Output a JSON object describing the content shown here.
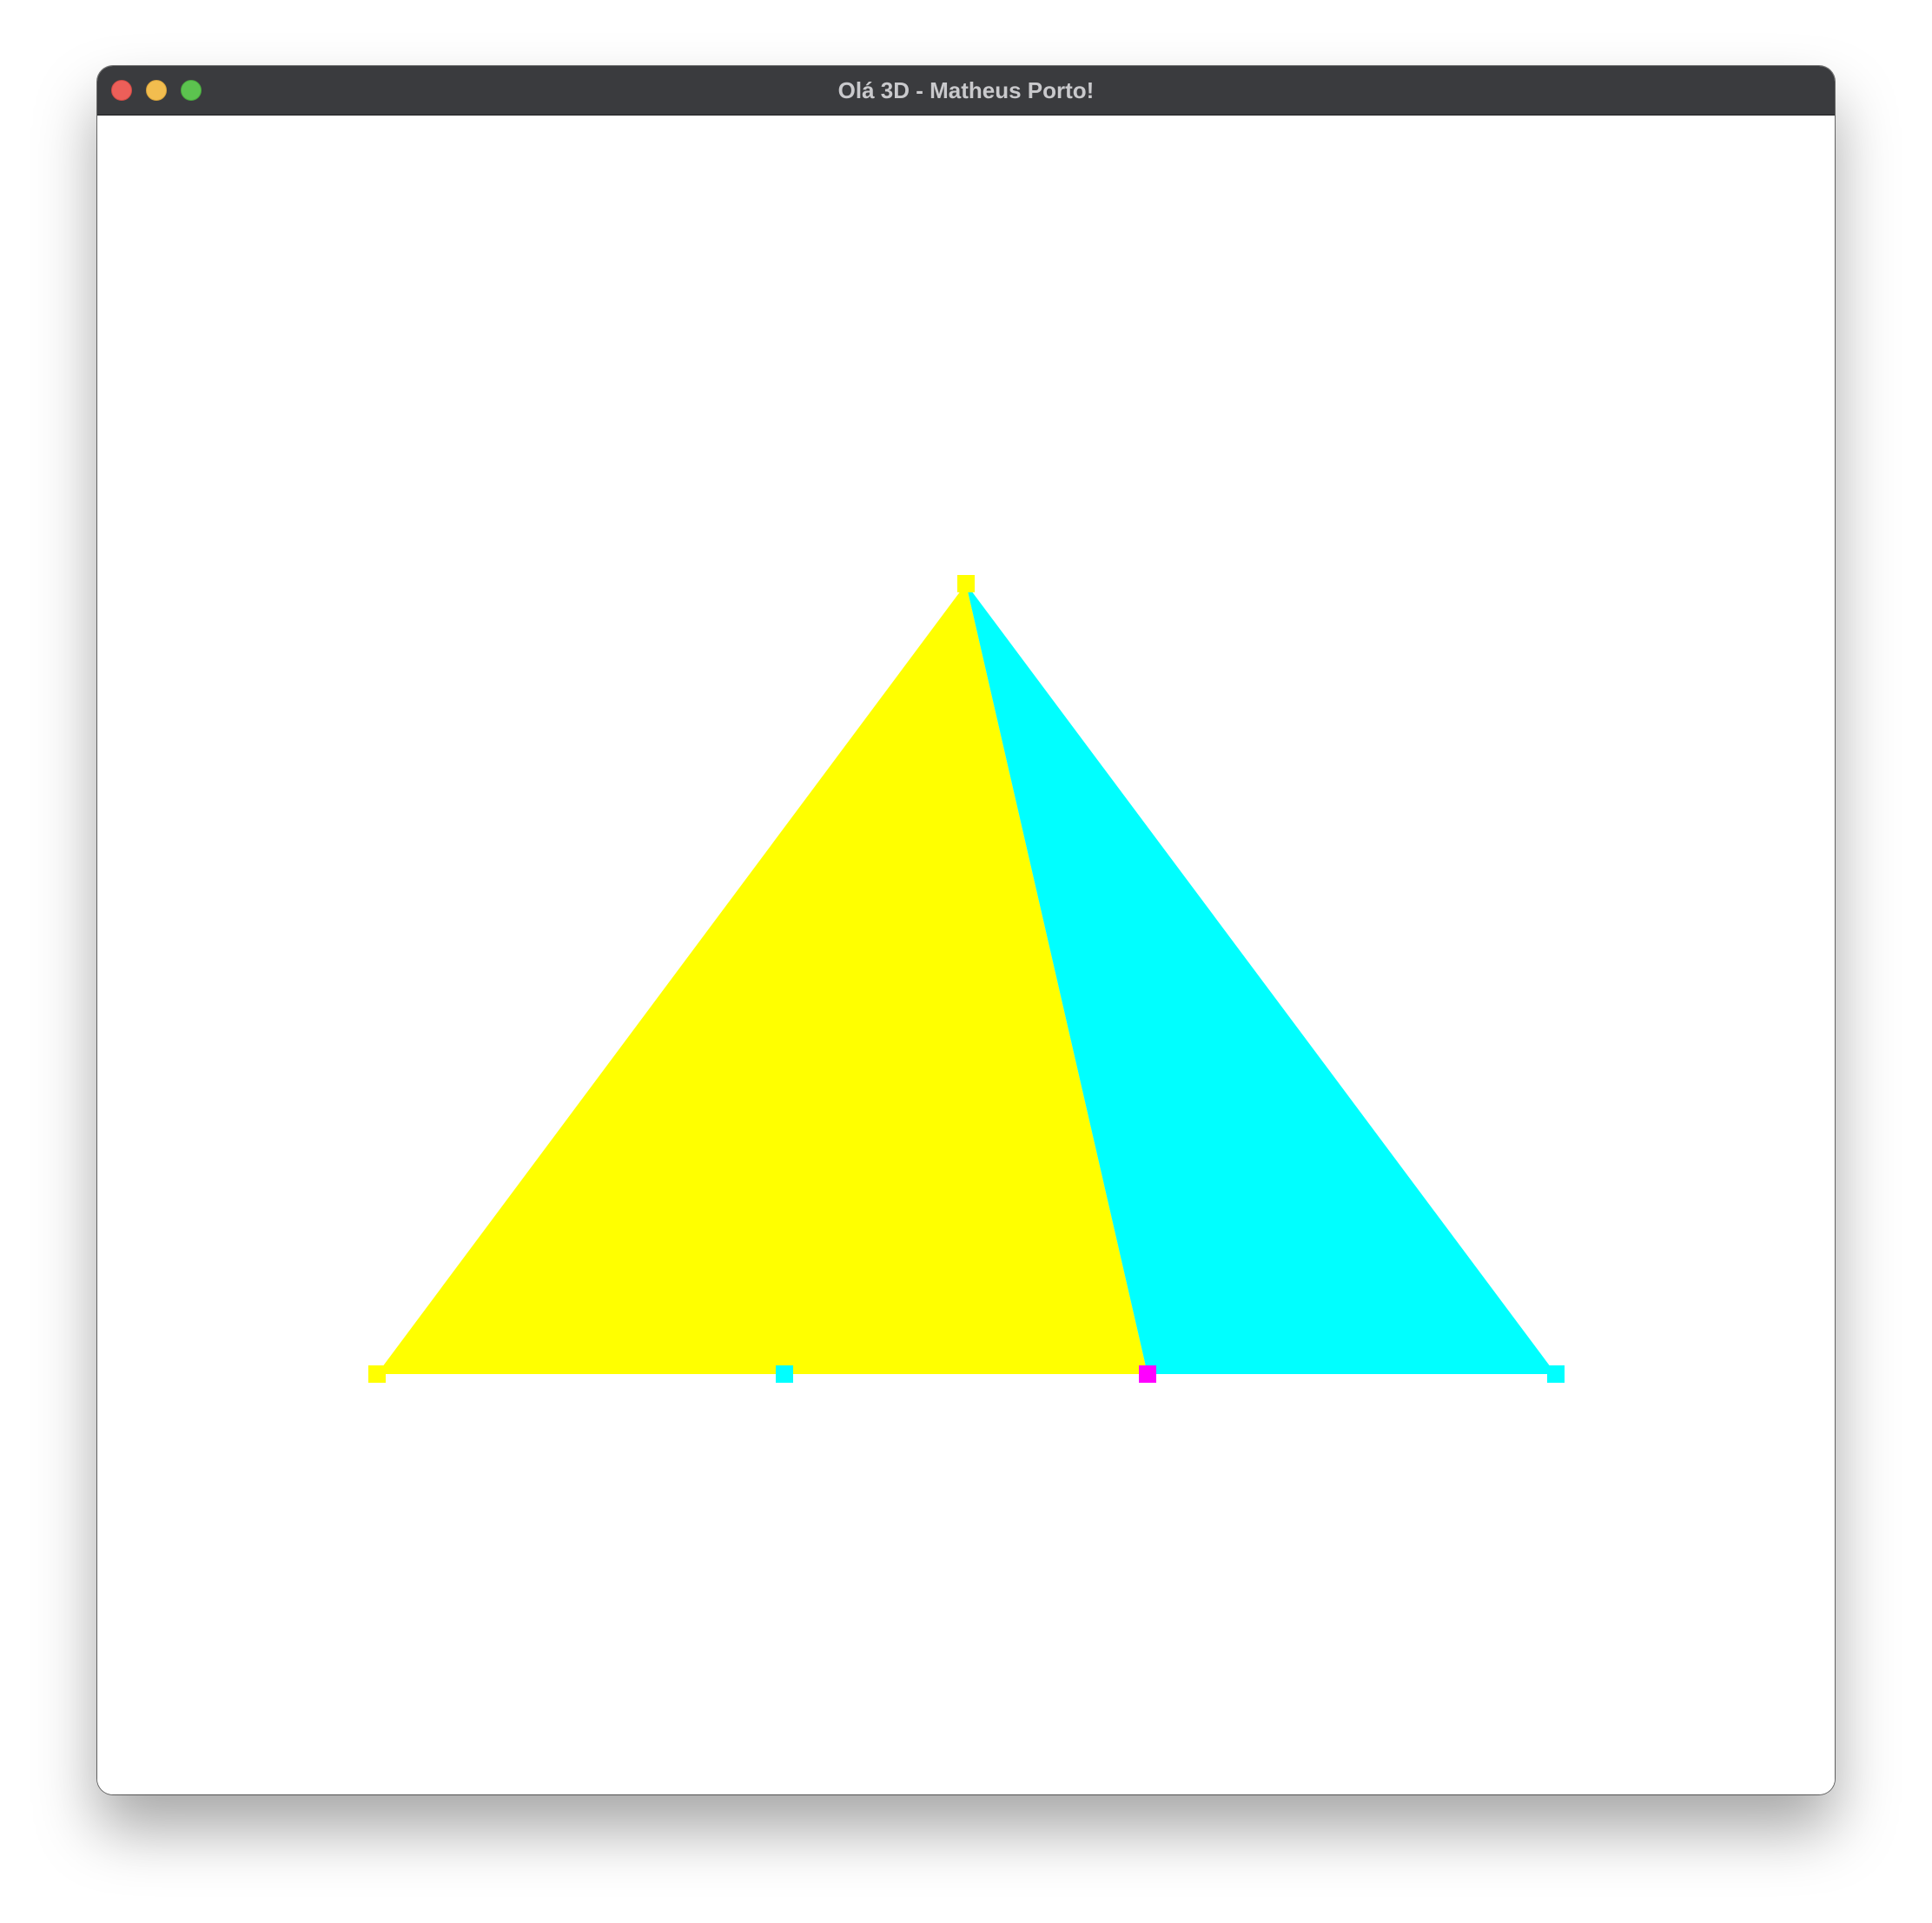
{
  "window": {
    "title": "Olá 3D - Matheus Porto!"
  },
  "titlebar": {
    "buttons": [
      {
        "name": "close",
        "color": "#ec5f59"
      },
      {
        "name": "minimize",
        "color": "#f2bd4f"
      },
      {
        "name": "maximize",
        "color": "#5cc34f"
      }
    ]
  },
  "scene": {
    "background": "#ffffff",
    "shapes": [
      {
        "name": "yellow-triangle",
        "color": "#ffff00"
      },
      {
        "name": "cyan-triangle",
        "color": "#00ffff"
      }
    ],
    "vertex_markers": [
      {
        "name": "apex-vertex",
        "color": "#ffff00"
      },
      {
        "name": "bottom-left-vertex",
        "color": "#ffff00"
      },
      {
        "name": "bottom-mid-left-vertex",
        "color": "#00ffff"
      },
      {
        "name": "bottom-split-vertex",
        "color": "#ff00ff"
      },
      {
        "name": "bottom-right-vertex",
        "color": "#00ffff"
      }
    ]
  }
}
